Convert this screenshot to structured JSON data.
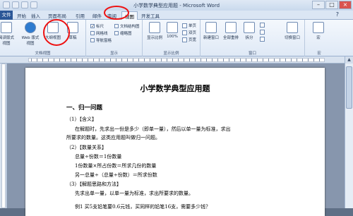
{
  "window": {
    "title": "小学数学典型应用题 - Microsoft Word"
  },
  "tabs": {
    "file": "文件",
    "items": [
      "开始",
      "插入",
      "页面布局",
      "引用",
      "邮件",
      "审阅",
      "视图",
      "开发工具"
    ],
    "active": "视图"
  },
  "ribbon": {
    "views_group": {
      "label": "文档视图",
      "buttons": [
        "页面视图",
        "阅读版式视图",
        "Web 版式视图",
        "大纲视图",
        "草稿"
      ]
    },
    "show_group": {
      "label": "显示",
      "items": [
        {
          "label": "标尺",
          "checked": true
        },
        {
          "label": "网格线",
          "checked": false
        },
        {
          "label": "导航窗格",
          "checked": false
        }
      ],
      "extra": [
        "文档结构图",
        "缩略图"
      ]
    },
    "zoom_group": {
      "label": "显示比例",
      "buttons": [
        "显示比例",
        "100%"
      ],
      "small": [
        "单页",
        "双页",
        "页宽"
      ]
    },
    "window_group": {
      "label": "窗口",
      "buttons": [
        "新建窗口",
        "全部重排",
        "拆分"
      ],
      "small_right": [
        "切换窗口"
      ]
    },
    "macro_group": {
      "label": "宏",
      "buttons": [
        "宏"
      ]
    }
  },
  "document": {
    "title": "小学数学典型应用题",
    "lines": [
      {
        "text": "一、归一问题",
        "kind": "h"
      },
      {
        "text": "（1）【含义】",
        "kind": "n"
      },
      {
        "text": "在解题时，先求出一份是多少（即单一量），然后以单一量为标准，求出",
        "kind": "n"
      },
      {
        "text": "所要求的数量。这类应用题叫做归一问题。",
        "kind": "n"
      },
      {
        "text": "（2）【数量关系】",
        "kind": "n"
      },
      {
        "text": "总量÷份数＝1份数量",
        "kind": "n"
      },
      {
        "text": "1份数量×所占份数＝所求几份的数量",
        "kind": "n"
      },
      {
        "text": "另一总量÷（总量÷份数）＝所求份数",
        "kind": "n"
      },
      {
        "text": "（3）【解题思路和方法】",
        "kind": "n"
      },
      {
        "text": "先求出单一量，以单一量为标准，求出所要求的数量。",
        "kind": "n"
      },
      {
        "text": "例1 买5支铅笔要0.6元钱，买同样的铅笔16支，需要多少钱？",
        "kind": "n"
      }
    ]
  },
  "colors": {
    "highlight_circle": "#e11111",
    "file_tab": "#2b5797"
  }
}
